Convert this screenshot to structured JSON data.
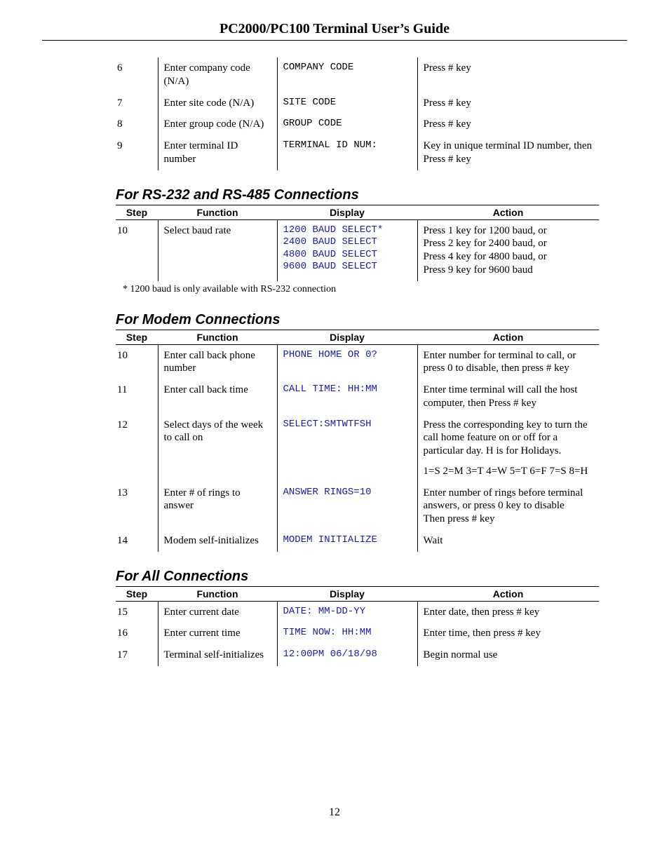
{
  "title": "PC2000/PC100 Terminal User’s Guide",
  "page_number": "12",
  "top_rows": [
    {
      "step": "6",
      "func": "Enter company code (N/A)",
      "disp": "COMPANY CODE",
      "action": "Press # key"
    },
    {
      "step": "7",
      "func": "Enter site code (N/A)",
      "disp": "SITE CODE",
      "action": "Press # key"
    },
    {
      "step": "8",
      "func": "Enter group code (N/A)",
      "disp": "GROUP CODE",
      "action": "Press # key"
    },
    {
      "step": "9",
      "func": "Enter terminal ID number",
      "disp": "TERMINAL ID NUM:",
      "action": "Key in unique terminal ID number, then Press # key"
    }
  ],
  "rs": {
    "heading": "For RS-232 and RS-485 Connections",
    "headers": {
      "step": "Step",
      "func": "Function",
      "disp": "Display",
      "action": "Action"
    },
    "rows": [
      {
        "step": "10",
        "func": "Select baud rate",
        "disp": "1200 BAUD SELECT*\n2400 BAUD SELECT\n4800 BAUD SELECT\n9600 BAUD SELECT",
        "action": "Press 1 key for 1200 baud, or\nPress 2 key for 2400 baud, or\nPress 4 key for 4800 baud, or\nPress 9 key for 9600 baud"
      }
    ],
    "footnote": "* 1200 baud is only available with RS-232 connection"
  },
  "modem": {
    "heading": "For Modem Connections",
    "headers": {
      "step": "Step",
      "func": "Function",
      "disp": "Display",
      "action": "Action"
    },
    "rows": [
      {
        "step": "10",
        "func": "Enter call back phone number",
        "disp": "PHONE HOME OR 0?",
        "action": "Enter number for terminal to call, or press 0 to disable, then press # key"
      },
      {
        "step": "11",
        "func": "Enter call back time",
        "disp": "CALL TIME: HH:MM",
        "action": "Enter time terminal will call the host computer, then Press # key"
      },
      {
        "step": "12",
        "func": "Select days of the week to call on",
        "disp": "SELECT:SMTWTFSH",
        "action_a": "Press the corresponding key to turn the call home feature on or off for a particular day. H is for Holidays.",
        "action_b": "1=S 2=M 3=T 4=W 5=T 6=F 7=S 8=H"
      },
      {
        "step": "13",
        "func": "Enter # of rings to answer",
        "disp": "ANSWER RINGS=10",
        "action": "Enter number of rings before terminal answers, or press 0 key to disable\nThen press # key"
      },
      {
        "step": "14",
        "func": "Modem self-initializes",
        "disp": "MODEM INITIALIZE",
        "action": "Wait"
      }
    ]
  },
  "all": {
    "heading": "For All Connections",
    "headers": {
      "step": "Step",
      "func": "Function",
      "disp": "Display",
      "action": "Action"
    },
    "rows": [
      {
        "step": "15",
        "func": "Enter current date",
        "disp": "DATE: MM-DD-YY",
        "action": "Enter date, then press # key"
      },
      {
        "step": "16",
        "func": "Enter current time",
        "disp": "TIME NOW: HH:MM",
        "action": "Enter time, then press # key"
      },
      {
        "step": "17",
        "func": "Terminal self-initializes",
        "disp": "12:00PM 06/18/98",
        "action": "Begin normal use"
      }
    ]
  }
}
